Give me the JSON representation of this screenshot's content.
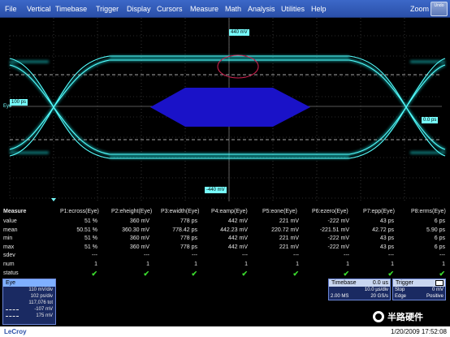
{
  "menu": [
    "File",
    "Vertical",
    "Timebase",
    "Trigger",
    "Display",
    "Cursors",
    "Measure",
    "Math",
    "Analysis",
    "Utilities",
    "Help"
  ],
  "zoom_label": "Zoom",
  "undo_label": "Undo",
  "wave": {
    "cursor_top": "440 mV",
    "cursor_bottom": "-440 mV",
    "left_label": "100 ps",
    "right_label": "0.0 ps",
    "channel_marker": "Eye"
  },
  "measure": {
    "title": "Measure",
    "columns": [
      "P1:ecross(Eye)",
      "P2:eheight(Eye)",
      "P3:ewidth(Eye)",
      "P4:eamp(Eye)",
      "P5:eone(Eye)",
      "P6:ezero(Eye)",
      "P7:epp(Eye)",
      "P8:erms(Eye)"
    ],
    "rows": [
      {
        "label": "value",
        "cells": [
          "51 %",
          "360 mV",
          "778 ps",
          "442 mV",
          "221 mV",
          "-222 mV",
          "43 ps",
          "6 ps"
        ]
      },
      {
        "label": "mean",
        "cells": [
          "50.51 %",
          "360.30 mV",
          "778.42 ps",
          "442.23 mV",
          "220.72 mV",
          "-221.51 mV",
          "42.72 ps",
          "5.90 ps"
        ]
      },
      {
        "label": "min",
        "cells": [
          "51 %",
          "360 mV",
          "778 ps",
          "442 mV",
          "221 mV",
          "-222 mV",
          "43 ps",
          "6 ps"
        ]
      },
      {
        "label": "max",
        "cells": [
          "51 %",
          "360 mV",
          "778 ps",
          "442 mV",
          "221 mV",
          "-222 mV",
          "43 ps",
          "6 ps"
        ]
      },
      {
        "label": "sdev",
        "cells": [
          "---",
          "---",
          "---",
          "---",
          "---",
          "---",
          "---",
          "---"
        ]
      },
      {
        "label": "num",
        "cells": [
          "1",
          "1",
          "1",
          "1",
          "1",
          "1",
          "1",
          "1"
        ]
      },
      {
        "label": "status",
        "cells": [
          "✔",
          "✔",
          "✔",
          "✔",
          "✔",
          "✔",
          "✔",
          "✔"
        ]
      }
    ]
  },
  "eye_panel": {
    "title": "Eye",
    "lines": [
      "110 mV/div",
      "102 ps/div",
      "117,076 tot",
      "-107 mV",
      "175 mV"
    ]
  },
  "timebase": {
    "title": "Timebase",
    "delay": "0.0 us",
    "tdiv": "10.0 µs/div",
    "samples": "2.00 MS",
    "rate": "20 GS/s"
  },
  "trigger": {
    "title": "Trigger",
    "mode": "Stop",
    "level": "0 mV",
    "type": "Edge",
    "slope": "Positive"
  },
  "footer": {
    "brand": "LeCroy",
    "datetime": "1/20/2009 17:52:08"
  },
  "watermark": "半路硬件",
  "colors": {
    "menubar": "#3c68c8",
    "trace": "#1ee6e6",
    "mask": "#1a12c8",
    "status_ok": "#3cdc2e"
  }
}
